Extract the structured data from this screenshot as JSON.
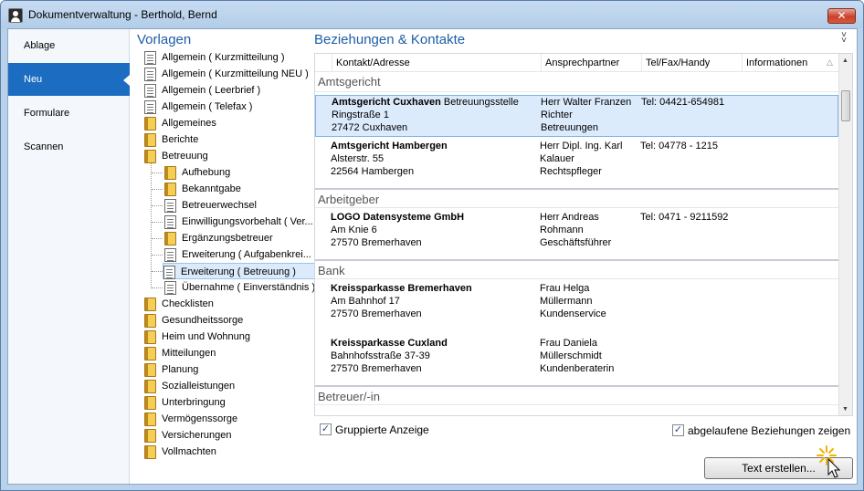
{
  "window": {
    "title": "Dokumentverwaltung - Berthold, Bernd",
    "close_label": "✕"
  },
  "nav": {
    "items": [
      {
        "label": "Ablage",
        "active": false
      },
      {
        "label": "Neu",
        "active": true
      },
      {
        "label": "Formulare",
        "active": false
      },
      {
        "label": "Scannen",
        "active": false
      }
    ]
  },
  "templates": {
    "title": "Vorlagen",
    "items": [
      {
        "label": "Allgemein ( Kurzmitteilung )",
        "icon": "document-icon",
        "level": 0
      },
      {
        "label": "Allgemein ( Kurzmitteilung NEU )",
        "icon": "document-icon",
        "level": 0
      },
      {
        "label": "Allgemein ( Leerbrief )",
        "icon": "document-icon",
        "level": 0
      },
      {
        "label": "Allgemein ( Telefax )",
        "icon": "document-icon",
        "level": 0
      },
      {
        "label": "Allgemeines",
        "icon": "folder-icon",
        "level": 0
      },
      {
        "label": "Berichte",
        "icon": "folder-icon",
        "level": 0
      },
      {
        "label": "Betreuung",
        "icon": "folder-icon",
        "level": 0
      },
      {
        "label": "Aufhebung",
        "icon": "folder-icon",
        "level": 1
      },
      {
        "label": "Bekanntgabe",
        "icon": "folder-icon",
        "level": 1
      },
      {
        "label": "Betreuerwechsel",
        "icon": "document-icon",
        "level": 1
      },
      {
        "label": "Einwilligungsvorbehalt ( Ver...",
        "icon": "document-icon",
        "level": 1
      },
      {
        "label": "Ergänzungsbetreuer",
        "icon": "folder-icon",
        "level": 1
      },
      {
        "label": "Erweiterung ( Aufgabenkrei...",
        "icon": "document-icon",
        "level": 1
      },
      {
        "label": "Erweiterung ( Betreuung )",
        "icon": "document-icon",
        "level": 1,
        "selected": true
      },
      {
        "label": "Übernahme ( Einverständnis )",
        "icon": "document-icon",
        "level": 1
      },
      {
        "label": "Checklisten",
        "icon": "folder-icon",
        "level": 0
      },
      {
        "label": "Gesundheitssorge",
        "icon": "folder-icon",
        "level": 0
      },
      {
        "label": "Heim und Wohnung",
        "icon": "folder-icon",
        "level": 0
      },
      {
        "label": "Mitteilungen",
        "icon": "folder-icon",
        "level": 0
      },
      {
        "label": "Planung",
        "icon": "folder-icon",
        "level": 0
      },
      {
        "label": "Sozialleistungen",
        "icon": "folder-icon",
        "level": 0
      },
      {
        "label": "Unterbringung",
        "icon": "folder-icon",
        "level": 0
      },
      {
        "label": "Vermögenssorge",
        "icon": "folder-icon",
        "level": 0
      },
      {
        "label": "Versicherungen",
        "icon": "folder-icon",
        "level": 0
      },
      {
        "label": "Vollmachten",
        "icon": "folder-icon",
        "level": 0
      }
    ]
  },
  "relations": {
    "title": "Beziehungen & Kontakte",
    "columns": [
      "Kontakt/Adresse",
      "Ansprechpartner",
      "Tel/Fax/Handy",
      "Informationen"
    ],
    "groups": [
      {
        "name": "Amtsgericht",
        "entries": [
          {
            "name": "Amtsgericht Cuxhaven",
            "suffix": "Betreuungsstelle",
            "street": "Ringstraße 1",
            "city": "27472 Cuxhaven",
            "contact": [
              "Herr Walter Franzen",
              "Richter",
              "Betreuungen"
            ],
            "phone": "Tel: 04421-654981",
            "selected": true
          },
          {
            "name": "Amtsgericht Hambergen",
            "suffix": "",
            "street": "Alsterstr. 55",
            "city": "22564 Hambergen",
            "contact": [
              "Herr Dipl. Ing. Karl",
              "Kalauer",
              "Rechtspfleger"
            ],
            "phone": "Tel: 04778 - 1215",
            "selected": false
          }
        ]
      },
      {
        "name": "Arbeitgeber",
        "entries": [
          {
            "name": "LOGO Datensysteme GmbH",
            "suffix": "",
            "street": "Am Knie 6",
            "city": "27570 Bremerhaven",
            "contact": [
              "Herr Andreas",
              "Rohmann",
              "Geschäftsführer"
            ],
            "phone": "Tel: 0471 - 9211592",
            "selected": false
          }
        ]
      },
      {
        "name": "Bank",
        "entries": [
          {
            "name": "Kreissparkasse Bremerhaven",
            "suffix": "",
            "street": "Am Bahnhof 17",
            "city": "27570 Bremerhaven",
            "contact": [
              "Frau Helga",
              "Müllermann",
              "Kundenservice"
            ],
            "phone": "",
            "selected": false
          },
          {
            "name": "Kreissparkasse Cuxland",
            "suffix": "",
            "street": "Bahnhofsstraße 37-39",
            "city": "27570 Bremerhaven",
            "contact": [
              "Frau Daniela",
              "Müllerschmidt",
              "Kundenberaterin"
            ],
            "phone": "",
            "selected": false
          }
        ]
      },
      {
        "name": "Betreuer/-in",
        "entries": []
      }
    ]
  },
  "options": {
    "grouped_label": "Gruppierte Anzeige",
    "grouped_checked": true,
    "expired_label": "abgelaufene Beziehungen zeigen",
    "expired_checked": true
  },
  "actions": {
    "create_text_label": "Text erstellen..."
  },
  "colors": {
    "accent": "#1c6dc1",
    "heading": "#1c5ea8",
    "selection": "#dcebfc"
  }
}
